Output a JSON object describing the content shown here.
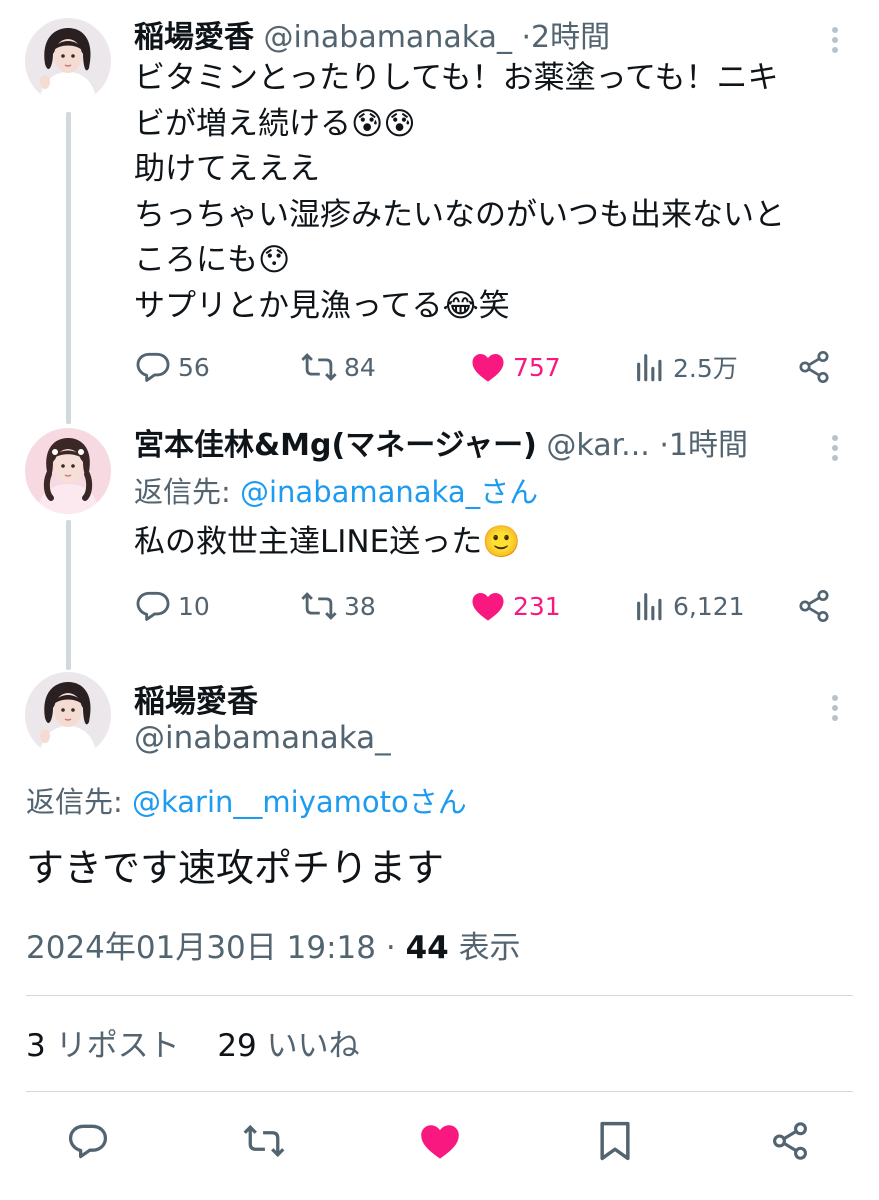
{
  "tweets": [
    {
      "name": "稲場愛香",
      "handle": "@inabamanaka_",
      "separator": "·",
      "time": "2時間",
      "lines": [
        "ビタミンとったりしても！お薬塗っても！ニキ",
        "ビが増え続ける😰😰",
        "助けてえええ",
        "ちっちゃい湿疹みたいなのがいつも出来ないと",
        "ころにも😯",
        "サプリとか見漁ってる😂笑"
      ],
      "replies": "56",
      "reposts": "84",
      "likes": "757",
      "views": "2.5万"
    },
    {
      "name": "宮本佳林&Mg(マネージャー)",
      "handle": "@kar...",
      "separator": "·",
      "time": "1時間",
      "reply_to_label": "返信先: ",
      "reply_to_mention": "@inabamanaka_さん",
      "lines": [
        "私の救世主達LINE送った🙂"
      ],
      "replies": "10",
      "reposts": "38",
      "likes": "231",
      "views": "6,121"
    }
  ],
  "main_tweet": {
    "name": "稲場愛香",
    "handle": "@inabamanaka_",
    "reply_to_label": "返信先: ",
    "reply_to_mention": "@karin__miyamotoさん",
    "text": "すきです速攻ポチります",
    "datetime": "2024年01月30日 19:18",
    "separator": "·",
    "views_count": "44",
    "views_label": "表示",
    "reposts_count": "3",
    "reposts_label": "リポスト",
    "likes_count": "29",
    "likes_label": "いいね"
  },
  "colors": {
    "text": "#0f1419",
    "secondary": "#536471",
    "accent": "#1d9bf0",
    "like": "#f91880",
    "divider": "#cfd9de"
  },
  "icons": [
    "reply-icon",
    "repost-icon",
    "like-icon",
    "views-icon",
    "share-icon",
    "bookmark-icon",
    "more-icon"
  ]
}
